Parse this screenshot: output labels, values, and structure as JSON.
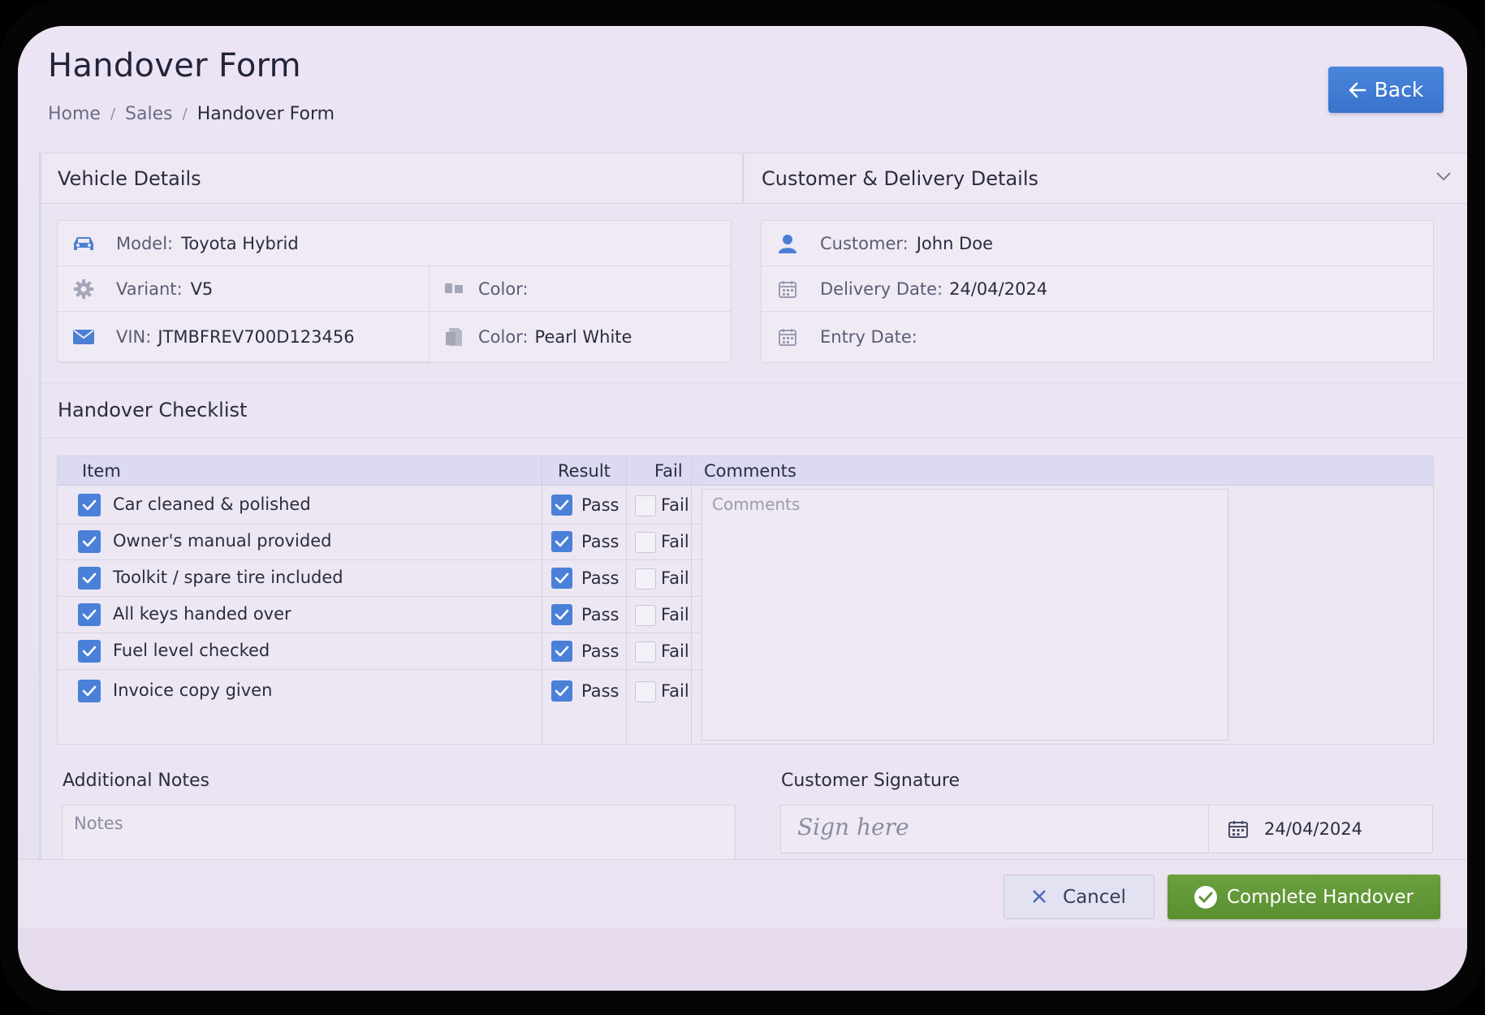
{
  "header": {
    "title": "Handover Form",
    "breadcrumb": [
      "Home",
      "Sales",
      "Handover Form"
    ],
    "breadcrumb_sep": "/",
    "back_label": "Back"
  },
  "vehicle": {
    "heading": "Vehicle Details",
    "model_label": "Model:",
    "model_value": "Toyota Hybrid",
    "variant_label": "Variant:",
    "variant_value": "V5",
    "color_label_1": "Color:",
    "vin_label": "VIN:",
    "vin_value": "JTMBFREV700D123456",
    "color_label_2": "Color:",
    "color_value_2": "Pearl White"
  },
  "customer": {
    "heading": "Customer & Delivery Details",
    "customer_label": "Customer:",
    "customer_value": "John Doe",
    "delivery_label": "Delivery Date:",
    "delivery_value": "24/04/2024",
    "entry_label": "Entry Date:"
  },
  "checklist": {
    "heading": "Handover Checklist",
    "columns": {
      "item": "Item",
      "result": "Result",
      "fail": "Fail",
      "comments": "Comments"
    },
    "pass_label": "Pass",
    "fail_label": "Fail",
    "comments_placeholder": "Comments",
    "rows": [
      {
        "item": "Car cleaned & polished",
        "checked": true,
        "pass": true,
        "fail": false
      },
      {
        "item": "Owner's manual provided",
        "checked": true,
        "pass": true,
        "fail": false
      },
      {
        "item": "Toolkit / spare tire included",
        "checked": true,
        "pass": true,
        "fail": false
      },
      {
        "item": "All keys handed over",
        "checked": true,
        "pass": true,
        "fail": false
      },
      {
        "item": "Fuel level checked",
        "checked": true,
        "pass": true,
        "fail": false
      },
      {
        "item": "Invoice copy given",
        "checked": true,
        "pass": true,
        "fail": false
      }
    ]
  },
  "notes": {
    "heading": "Additional Notes",
    "placeholder": "Notes"
  },
  "signature": {
    "heading": "Customer Signature",
    "placeholder": "Sign here",
    "date": "24/04/2024"
  },
  "footer": {
    "cancel_label": "Cancel",
    "complete_label": "Complete Handover"
  },
  "colors": {
    "primary": "#4a80d8",
    "success": "#5f9635",
    "background": "#ebe4f2"
  },
  "icons": {
    "back": "arrow-left-icon",
    "model": "car-icon",
    "variant": "gear-icon",
    "color": "flag-icon",
    "vin": "envelope-icon",
    "color_value": "document-icon",
    "customer": "user-icon",
    "delivery": "calendar-icon",
    "entry": "calendar-icon",
    "cancel": "close-icon",
    "complete": "check-circle-icon"
  }
}
